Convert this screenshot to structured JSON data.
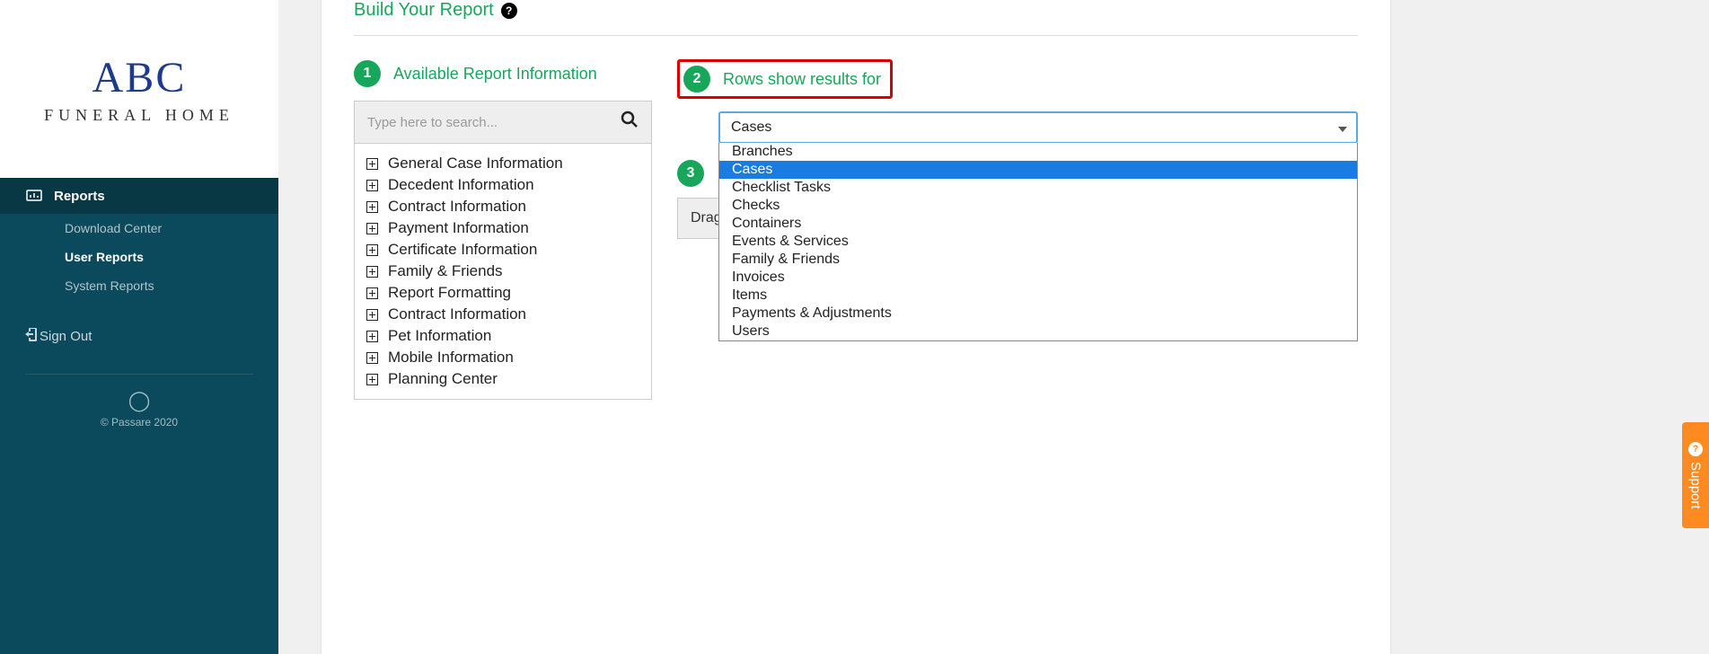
{
  "logo": {
    "main": "ABC",
    "sub": "FUNERAL HOME"
  },
  "nav": {
    "reports": "Reports",
    "download_center": "Download Center",
    "user_reports": "User Reports",
    "system_reports": "System Reports",
    "sign_out": "Sign Out"
  },
  "footer": {
    "copy": "© Passare 2020"
  },
  "page": {
    "title": "Build Your Report",
    "step1_label": "Available Report Information",
    "step2_label": "Rows show results for",
    "search_placeholder": "Type here to search...",
    "drag_label": "Drag"
  },
  "tree": {
    "items": [
      "General Case Information",
      "Decedent Information",
      "Contract Information",
      "Payment Information",
      "Certificate Information",
      "Family & Friends",
      "Report Formatting",
      "Contract Information",
      "Pet Information",
      "Mobile Information",
      "Planning Center"
    ]
  },
  "select": {
    "value": "Cases",
    "options": [
      "Branches",
      "Cases",
      "Checklist Tasks",
      "Checks",
      "Containers",
      "Events & Services",
      "Family & Friends",
      "Invoices",
      "Items",
      "Payments & Adjustments",
      "Users"
    ],
    "selected_index": 1
  },
  "support": "Support",
  "steps": {
    "one": "1",
    "two": "2",
    "three": "3"
  }
}
